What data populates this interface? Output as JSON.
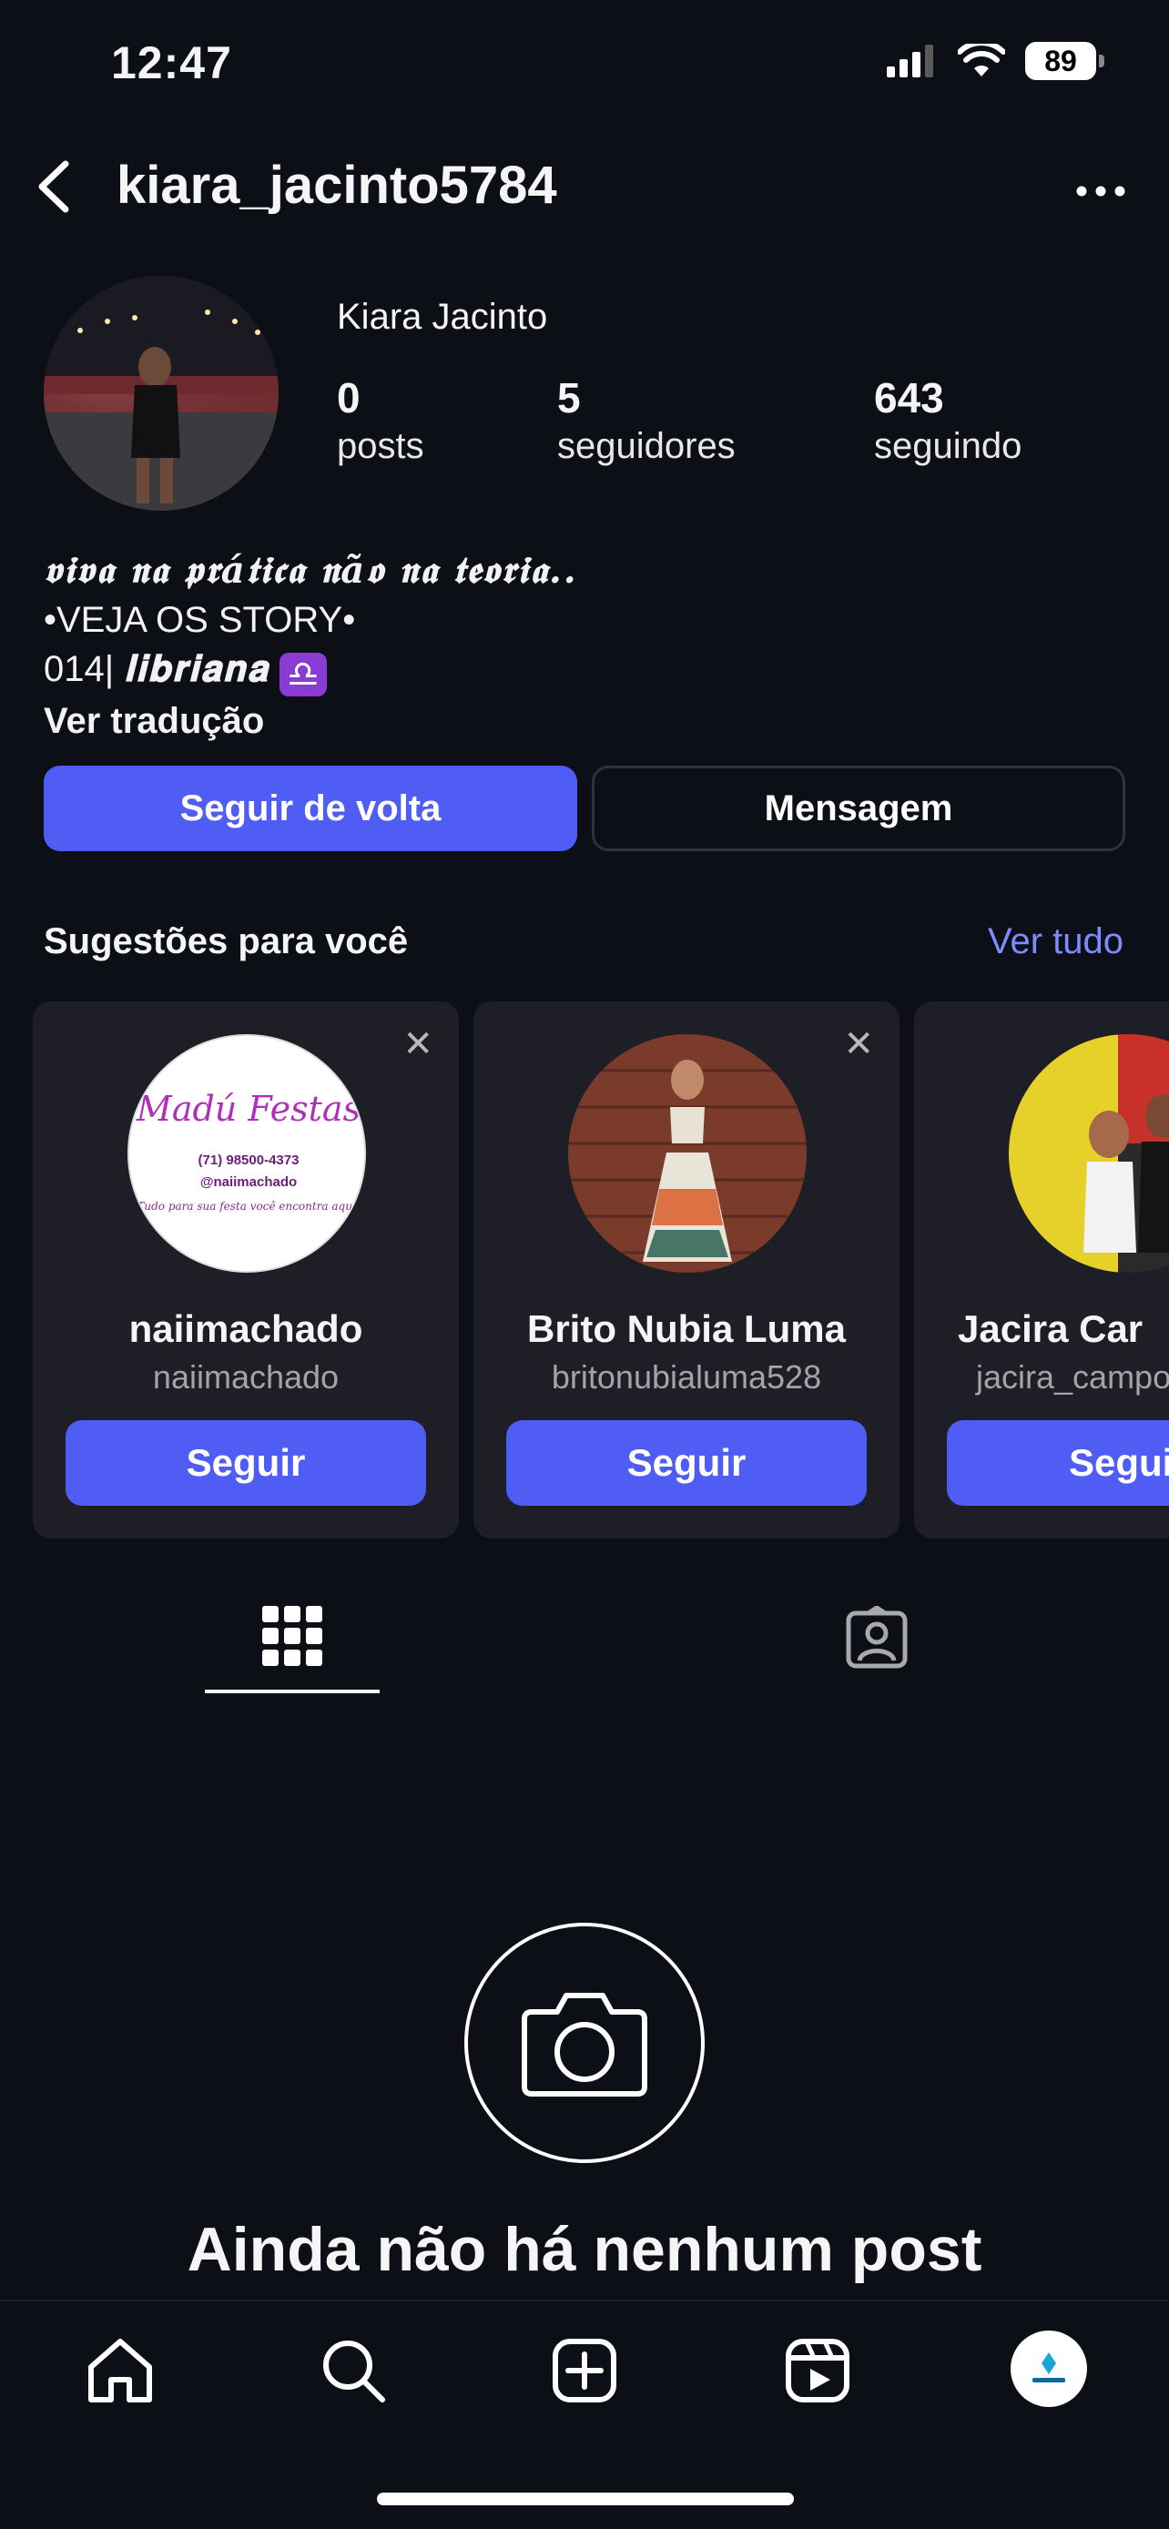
{
  "status": {
    "time": "12:47",
    "battery": "89"
  },
  "header": {
    "username": "kiara_jacinto5784"
  },
  "profile": {
    "full_name": "Kiara Jacinto",
    "stats": [
      {
        "value": "0",
        "label": "posts"
      },
      {
        "value": "5",
        "label": "seguidores"
      },
      {
        "value": "643",
        "label": "seguindo"
      }
    ],
    "bio_line1": "𝖛𝖎𝖛𝖆 𝖓𝖆 𝖕𝖗á𝖙𝖎𝖈𝖆 𝖓ã𝖔 𝖓𝖆 𝖙𝖊𝖔𝖗𝖎𝖆..",
    "bio_line2": "•VEJA OS STORY•",
    "bio_line3_prefix": "014| ",
    "bio_line3_word": "𝐥𝐢𝐛𝐫𝐢𝐚𝐧𝐚",
    "bio_zodiac": "♎",
    "see_translation": "Ver tradução"
  },
  "actions": {
    "follow_back": "Seguir de volta",
    "message": "Mensagem"
  },
  "suggestions": {
    "title": "Sugestões para você",
    "see_all": "Ver tudo",
    "cards": [
      {
        "name": "naiimachado",
        "handle": "naiimachado",
        "button": "Seguir",
        "logo_title": "Madú Festas",
        "logo_phone": "(71) 98500-4373",
        "logo_ig": "@naiimachado",
        "logo_tagline": "Tudo para sua festa você encontra aqui!"
      },
      {
        "name": "Brito Nubia Luma",
        "handle": "britonubialuma528",
        "button": "Seguir"
      },
      {
        "name": "Jacira Car",
        "handle": "jacira_campo",
        "button": "Segui"
      }
    ]
  },
  "empty": {
    "title": "Ainda não há nenhum post"
  },
  "bottom_nav": [
    "home-icon",
    "search-icon",
    "create-icon",
    "reels-icon",
    "profile-avatar"
  ],
  "colors": {
    "accent": "#4f5df5",
    "link": "#7c8cff",
    "background": "#0c0f16",
    "card": "#1e1f26"
  }
}
